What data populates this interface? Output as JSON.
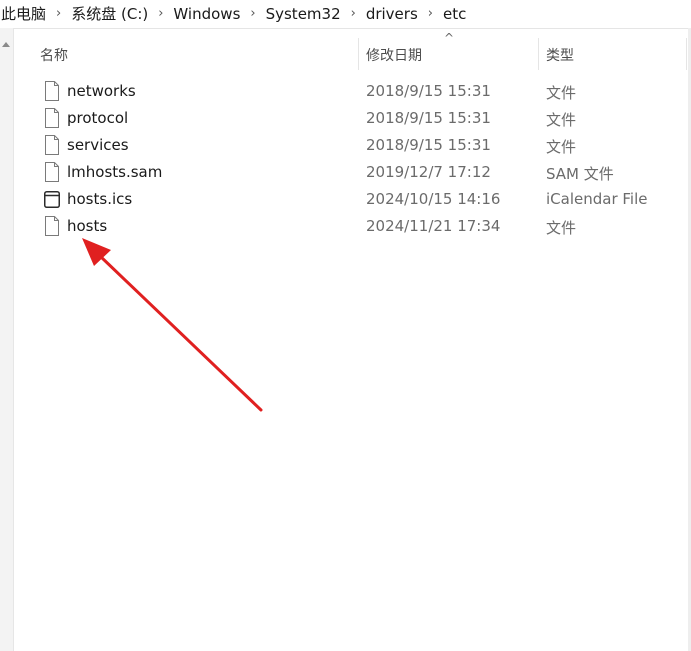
{
  "breadcrumb": {
    "items": [
      "此电脑",
      "系统盘 (C:)",
      "Windows",
      "System32",
      "drivers",
      "etc"
    ],
    "separator": "›"
  },
  "columns": {
    "name": "名称",
    "date": "修改日期",
    "type": "类型",
    "sort_indicator": "^"
  },
  "files": [
    {
      "name": "networks",
      "date": "2018/9/15 15:31",
      "type": "文件",
      "icon": "file-icon"
    },
    {
      "name": "protocol",
      "date": "2018/9/15 15:31",
      "type": "文件",
      "icon": "file-icon"
    },
    {
      "name": "services",
      "date": "2018/9/15 15:31",
      "type": "文件",
      "icon": "file-icon"
    },
    {
      "name": "lmhosts.sam",
      "date": "2019/12/7 17:12",
      "type": "SAM 文件",
      "icon": "file-icon"
    },
    {
      "name": "hosts.ics",
      "date": "2024/10/15 14:16",
      "type": "iCalendar File",
      "icon": "calendar-file-icon"
    },
    {
      "name": "hosts",
      "date": "2024/11/21 17:34",
      "type": "文件",
      "icon": "file-icon"
    }
  ],
  "annotation": {
    "type": "arrow",
    "color": "#e02020",
    "target": "hosts"
  }
}
